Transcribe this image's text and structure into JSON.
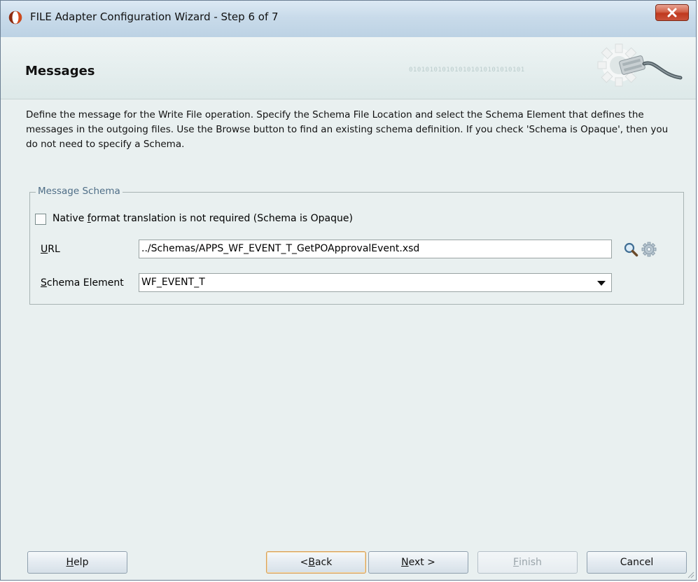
{
  "window": {
    "title": "FILE Adapter Configuration Wizard - Step 6 of 7"
  },
  "header": {
    "title": "Messages",
    "decoration_text": "0101010101010101010101010101"
  },
  "description": "Define the message for the Write File operation.  Specify the Schema File Location and select the Schema Element that defines the messages in the outgoing files. Use the Browse button to find an existing schema definition. If you check 'Schema is Opaque', then you do not need to specify a Schema.",
  "message_schema": {
    "group_title": "Message Schema",
    "opaque_checkbox": {
      "label_pre": "Native ",
      "label_mnemonic": "f",
      "label_post": "ormat translation is not required (Schema is Opaque)",
      "checked": false
    },
    "url": {
      "label_mnemonic": "U",
      "label_post": "RL",
      "value": "../Schemas/APPS_WF_EVENT_T_GetPOApprovalEvent.xsd"
    },
    "schema_element": {
      "label_mnemonic": "S",
      "label_post": "chema Element",
      "selected": "WF_EVENT_T"
    },
    "icons": {
      "browse": "search-icon",
      "generate": "gear-icon"
    }
  },
  "buttons": {
    "help": {
      "mnemonic": "H",
      "rest": "elp"
    },
    "back": {
      "pre": "< ",
      "mnemonic": "B",
      "rest": "ack"
    },
    "next": {
      "mnemonic": "N",
      "rest": "ext >"
    },
    "finish": {
      "mnemonic": "F",
      "rest": "inish",
      "enabled": false
    },
    "cancel": {
      "label": "Cancel"
    }
  },
  "colors": {
    "body_bg": "#e9f0f0",
    "group_title": "#4f6e87",
    "close_button": "#c9523a"
  }
}
